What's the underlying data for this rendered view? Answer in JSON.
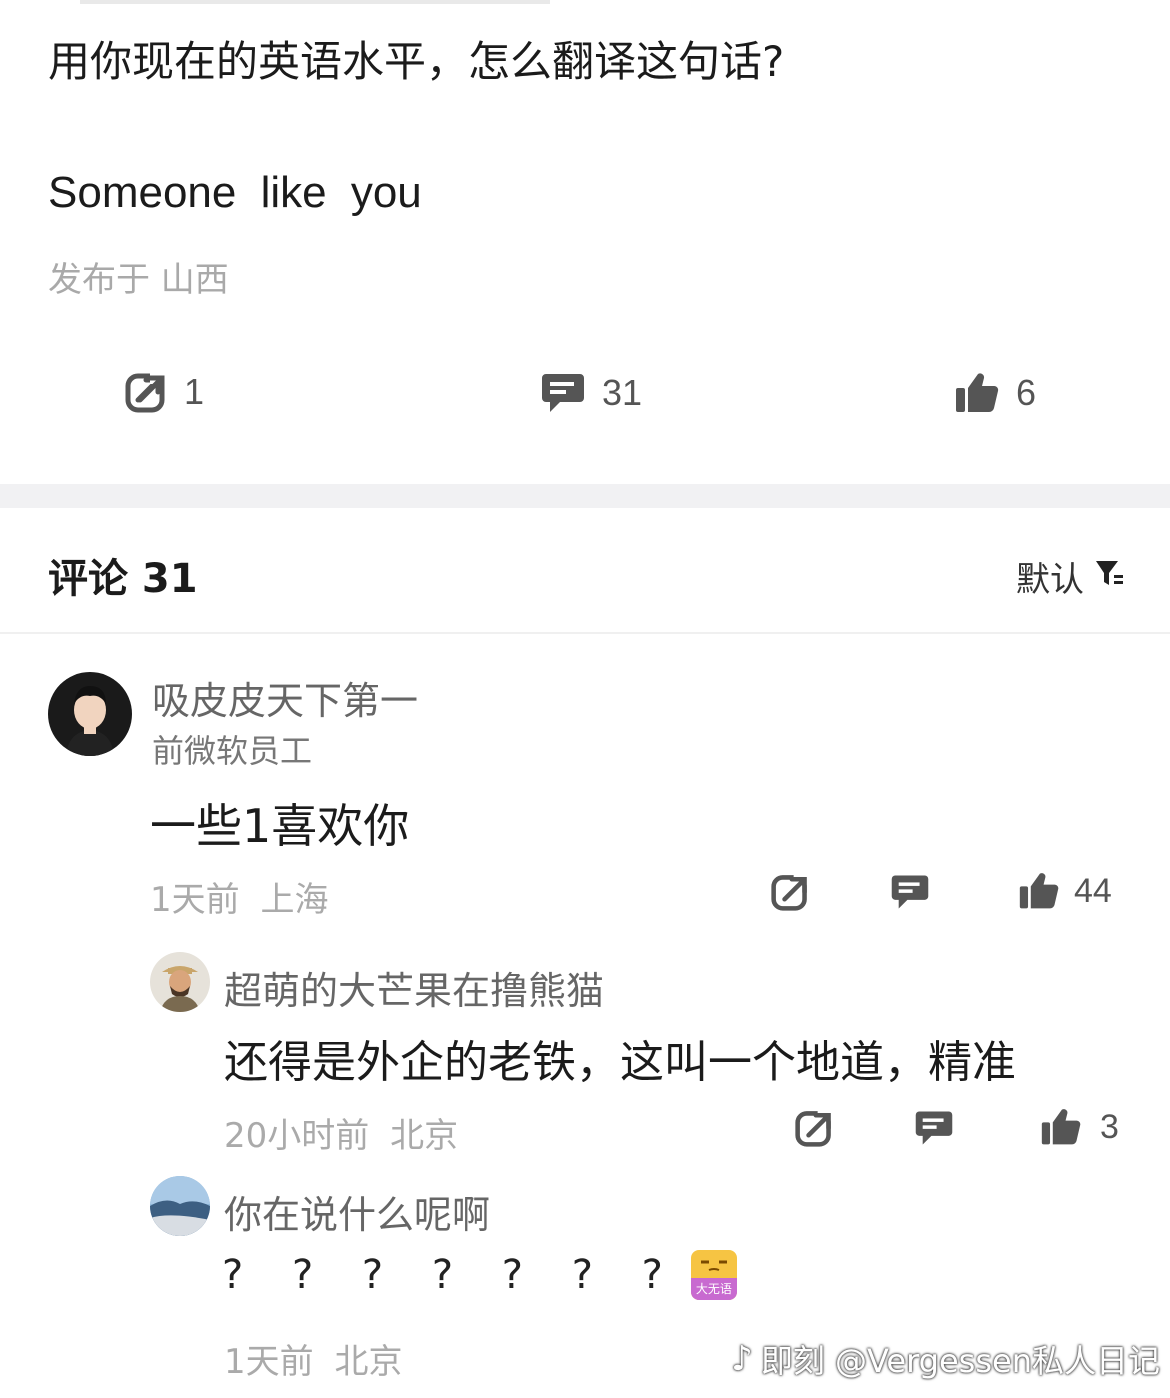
{
  "post": {
    "title": "用你现在的英语水平，怎么翻译这句话?",
    "body": "Someone like you",
    "location": "发布于 山西",
    "stats": {
      "share": "1",
      "comment": "31",
      "like": "6"
    }
  },
  "comments_header": {
    "title": "评论 31",
    "sort_label": "默认"
  },
  "comments": [
    {
      "user": "吸皮皮天下第一",
      "user_title": "前微软员工",
      "text": "一些1喜欢你",
      "meta": "1天前 上海",
      "likes": "44"
    }
  ],
  "replies": [
    {
      "user": "超萌的大芒果在撸熊猫",
      "text": "还得是外企的老铁，这叫一个地道，精准",
      "meta": "20小时前 北京",
      "likes": "3"
    },
    {
      "user": "你在说什么呢啊",
      "text": "? ? ? ? ? ? ?",
      "sticker_label": "大无语",
      "meta": "1天前 北京"
    }
  ],
  "watermark": "即刻 @Vergessen私人日记",
  "colors": {
    "icon": "#555555",
    "meta": "#aaaaaa",
    "separator": "#f1f1f3"
  }
}
